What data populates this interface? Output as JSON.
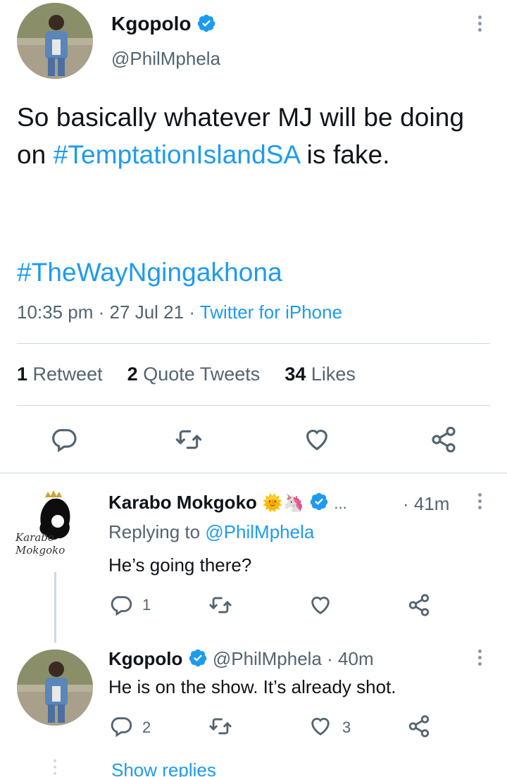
{
  "main_tweet": {
    "author_name": "Kgopolo",
    "author_handle": "@PhilMphela",
    "text_plain": "So basically whatever MJ will be doing on ",
    "hashtag1": "#TemptationIslandSA",
    "text_after": " is fake.",
    "hashtag2": "#TheWayNgingakhona",
    "time": "10:35 pm",
    "date": "27 Jul 21",
    "sep": "·",
    "client": "Twitter for iPhone",
    "retweets_count": "1",
    "retweets_label": "Retweet",
    "quotes_count": "2",
    "quotes_label": "Quote Tweets",
    "likes_count": "34",
    "likes_label": "Likes"
  },
  "replies": [
    {
      "author_name": "Karabo Mokgoko",
      "emojis": "🌞🦄",
      "ellipsis": "...",
      "time": "· 41m",
      "replying_prefix": "Replying to ",
      "replying_to": "@PhilMphela",
      "text": "He’s going there?",
      "reply_count": "1",
      "retweet_count": "",
      "like_count": "",
      "avatar_text": "Karabo Mokgoko"
    },
    {
      "author_name": "Kgopolo",
      "author_handle": "@PhilMphela",
      "time": "· 40m",
      "text": "He is on the show. It’s already shot.",
      "reply_count": "2",
      "retweet_count": "",
      "like_count": "3"
    }
  ],
  "show_replies": "Show replies",
  "colors": {
    "accent": "#1d9bf0",
    "text": "#0f1419",
    "secondary": "#536471",
    "divider": "#cfd9de"
  },
  "icons": {
    "reply": "reply-icon",
    "retweet": "retweet-icon",
    "like": "heart-icon",
    "share": "share-icon",
    "verified": "verified-badge-icon",
    "more": "more-vertical-icon"
  }
}
